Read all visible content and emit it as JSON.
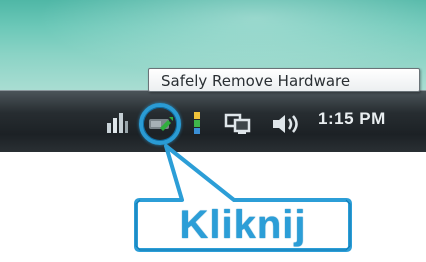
{
  "tooltip": {
    "text": "Safely Remove Hardware"
  },
  "taskbar": {
    "clock": "1:15 PM"
  },
  "tray_icons": [
    "network-icon",
    "safely-remove-hardware-icon",
    "updates-icon",
    "display-icon",
    "volume-icon"
  ],
  "annotation": {
    "label": "Kliknij"
  },
  "colors": {
    "accent": "#2c9ed7",
    "taskbar": "#1c2125",
    "desktop": "#6cc8b8",
    "tooltip_bg": "#ffffff"
  }
}
